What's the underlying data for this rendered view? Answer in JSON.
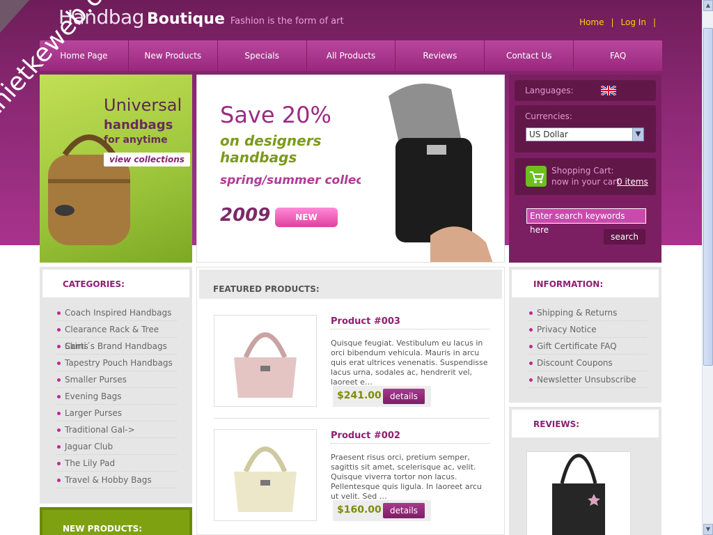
{
  "brand": {
    "name_part1": "Handbag",
    "name_part2": "Boutique",
    "tagline": "Fashion is the form of art"
  },
  "toplinks": {
    "home": "Home",
    "login": "Log In",
    "sep": "|"
  },
  "nav": [
    "Home Page",
    "New Products",
    "Specials",
    "All Products",
    "Reviews",
    "Contact Us",
    "FAQ"
  ],
  "banner_left": {
    "line1": "Universal",
    "line2": "handbags",
    "line3": "for anytime",
    "cta": "view collections"
  },
  "banner_mid": {
    "save": "Save 20%",
    "design": "on designers handbags",
    "collection": "spring/summer collection",
    "year": "2009",
    "badge": "NEW"
  },
  "sidebar": {
    "languages_label": "Languages:",
    "currencies_label": "Currencies:",
    "currency_selected": "US Dollar",
    "cart_label": "Shopping Cart:",
    "cart_text": "now in your cart",
    "cart_count": "0 items",
    "search_placeholder": "Enter search keywords here",
    "search_button": "search"
  },
  "categories": {
    "heading": "CATEGORIES:",
    "items": [
      "Coach Inspired Handbags",
      "Clearance Rack & Tree Skirts",
      "Cami´s Brand Handbags",
      "Tapestry Pouch Handbags",
      "Smaller Purses",
      "Evening Bags",
      "Larger Purses",
      "Traditional Gal->",
      "Jaguar Club",
      "The Lily Pad",
      "Travel & Hobby Bags"
    ]
  },
  "new_products": {
    "heading": "NEW PRODUCTS:"
  },
  "featured": {
    "heading": "FEATURED PRODUCTS:",
    "products": [
      {
        "title": "Product #003",
        "desc": "Quisque feugiat. Vestibulum eu lacus in orci bibendum vehicula. Mauris in arcu quis erat ultrices venenatis. Suspendisse lacus urna, sodales ac, hendrerit vel, laoreet e…",
        "price": "$241.00",
        "button": "details"
      },
      {
        "title": "Product #002",
        "desc": "Praesent risus orci, pretium semper, sagittis sit amet, scelerisque ac, velit. Quisque viverra tortor non lacus. Pellentesque quis ligula. In laoreet arcu ut velit. Sed …",
        "price": "$160.00",
        "button": "details"
      }
    ]
  },
  "information": {
    "heading": "INFORMATION:",
    "items": [
      "Shipping & Returns",
      "Privacy Notice",
      "Gift Certificate FAQ",
      "Discount Coupons",
      "Newsletter Unsubscribe"
    ]
  },
  "reviews": {
    "heading": "REVIEWS:"
  },
  "watermark": "thietkeweb.com",
  "colors": {
    "brand": "#8a2873",
    "accent_green": "#7b8d0a",
    "link_yellow": "#ffd300"
  }
}
